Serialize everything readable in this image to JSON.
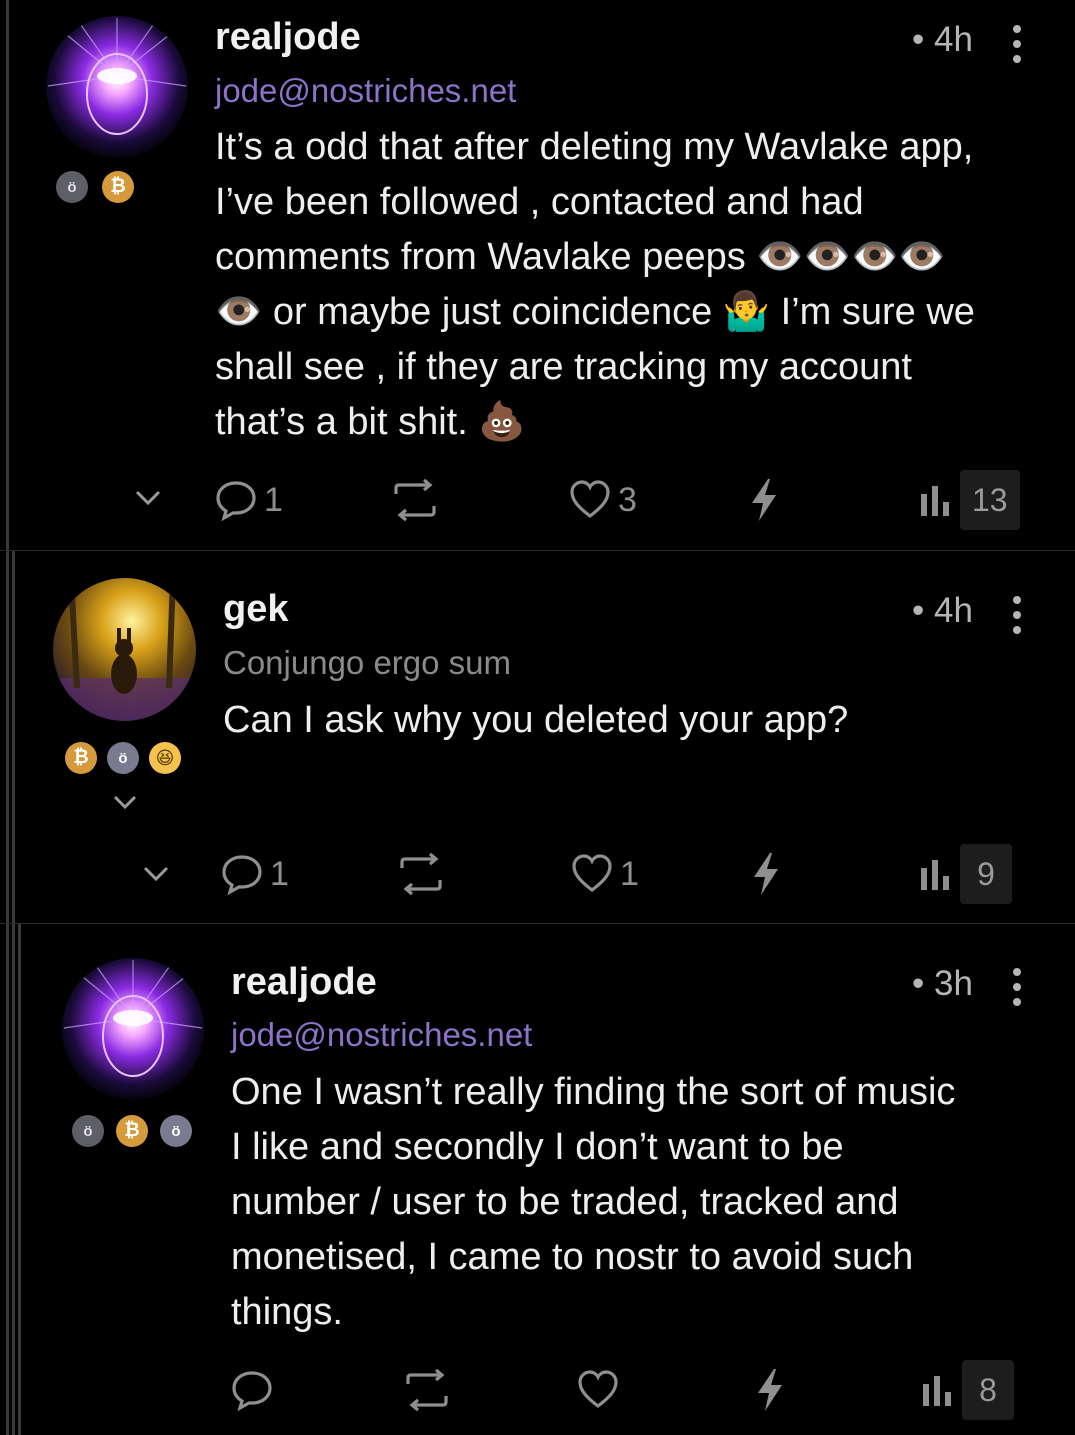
{
  "posts": [
    {
      "username": "realjode",
      "handle": "jode@nostriches.net",
      "time": "• 4h",
      "content": "It’s a odd that after deleting my Wavlake app,\nI’ve been followed , contacted and had\ncomments from Wavlake peeps 👁️👁️👁️👁️\n👁️ or maybe just coincidence 🤷‍♂️ I’m sure we\nshall see , if they are tracking my account\nthat’s a bit shit.  💩",
      "badges": [
        "robot-badge",
        "bitcoin-badge"
      ],
      "replies": "1",
      "reposts": "",
      "likes": "3",
      "views": "13"
    },
    {
      "username": "gek",
      "handle": "Conjungo ergo sum",
      "time": "• 4h",
      "content": "Can I ask why you deleted your app?",
      "badges": [
        "bitcoin-badge",
        "robot-badge",
        "laughing-badge"
      ],
      "replies": "1",
      "reposts": "",
      "likes": "1",
      "views": "9"
    },
    {
      "username": "realjode",
      "handle": "jode@nostriches.net",
      "time": "• 3h",
      "content": "One I wasn’t really finding the sort of music\nI like and secondly I don’t want to be\nnumber / user to be traded, tracked and\nmonetised, I came to nostr to avoid such\nthings.",
      "badges": [
        "robot-badge",
        "bitcoin-badge",
        "robot-badge"
      ],
      "replies": "",
      "reposts": "",
      "likes": "",
      "views": "8"
    }
  ],
  "badge_glyphs": {
    "bitcoin": "₿",
    "robot": "ö",
    "laugh": "😆"
  },
  "colors": {
    "background": "#000000",
    "handle_purple": "#8e72c9",
    "bitcoin_orange": "#d59a3c",
    "icon_gray": "#8f8f8f"
  }
}
